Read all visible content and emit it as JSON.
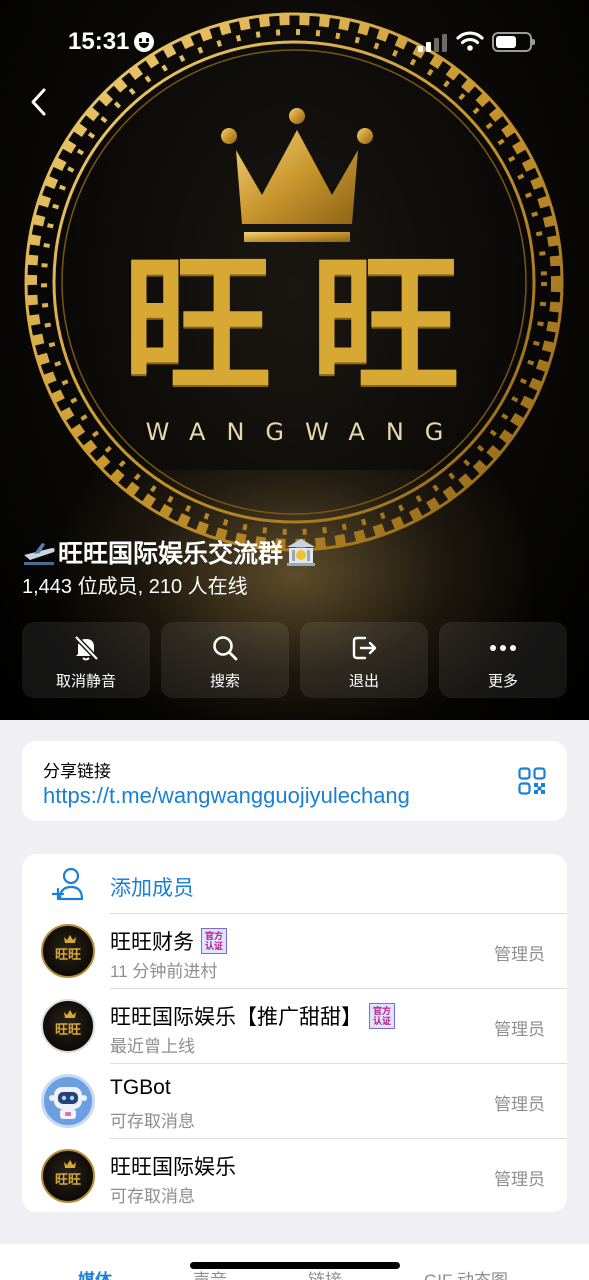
{
  "status_bar": {
    "time": "15:31"
  },
  "header": {
    "logo_chars": [
      "旺",
      "旺"
    ],
    "logo_subtitle": "WANGWANG",
    "title": "旺旺国际娱乐交流群",
    "subtitle": "1,443 位成员, 210  人在线",
    "colors": {
      "gold": "#d7a834",
      "bg": "#000000"
    }
  },
  "actions": [
    {
      "label": "取消静音",
      "icon": "bell-slash-icon"
    },
    {
      "label": "搜索",
      "icon": "search-icon"
    },
    {
      "label": "退出",
      "icon": "leave-icon"
    },
    {
      "label": "更多",
      "icon": "more-icon"
    }
  ],
  "share": {
    "label": "分享链接",
    "link": "https://t.me/wangwangguojiyulechang"
  },
  "members": {
    "add_label": "添加成员",
    "list": [
      {
        "name": "旺旺财务",
        "status": "11 分钟前进村",
        "role": "管理员",
        "badge": [
          "官方",
          "认证"
        ]
      },
      {
        "name": "旺旺国际娱乐【推广甜甜】",
        "status": "最近曾上线",
        "role": "管理员",
        "badge": [
          "官方",
          "认证"
        ]
      },
      {
        "name": "TGBot",
        "status": "可存取消息",
        "role": "管理员"
      },
      {
        "name": "旺旺国际娱乐",
        "status": "可存取消息",
        "role": "管理员"
      }
    ],
    "avatar_text": "旺旺"
  },
  "tabs": [
    {
      "label": "媒体",
      "active": true
    },
    {
      "label": "声音"
    },
    {
      "label": "链接"
    },
    {
      "label": "GIF 动态图"
    }
  ],
  "accent_color": "#1a7fd9"
}
